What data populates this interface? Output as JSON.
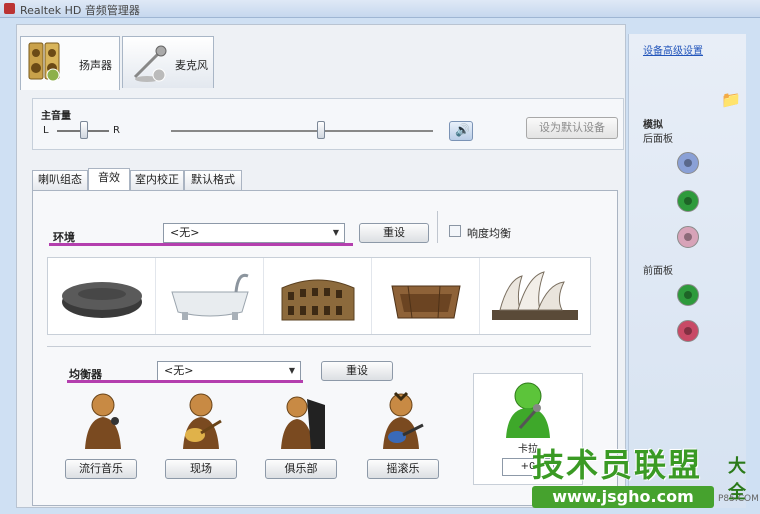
{
  "window": {
    "title": "Realtek HD 音频管理器"
  },
  "device_tabs": [
    {
      "label": "扬声器"
    },
    {
      "label": "麦克风"
    }
  ],
  "volume": {
    "title": "主音量",
    "left_label": "L",
    "right_label": "R",
    "set_default_label": "设为默认设备"
  },
  "sub_tabs": [
    {
      "label": "喇叭组态"
    },
    {
      "label": "音效"
    },
    {
      "label": "室内校正"
    },
    {
      "label": "默认格式"
    }
  ],
  "environment": {
    "label": "环境",
    "selected": "<无>",
    "reset_label": "重设",
    "loudness_label": "响度均衡",
    "loudness_checked": false,
    "thumbnails": [
      "stone-disc-icon",
      "bathtub-icon",
      "colosseum-icon",
      "arena-icon",
      "opera-house-icon"
    ]
  },
  "equalizer": {
    "label": "均衡器",
    "selected": "<无>",
    "reset_label": "重设",
    "presets": [
      {
        "label": "流行音乐"
      },
      {
        "label": "现场"
      },
      {
        "label": "俱乐部"
      },
      {
        "label": "摇滚乐"
      }
    ]
  },
  "karaoke": {
    "label": "卡拉",
    "value": "+0"
  },
  "right_panel": {
    "advanced_link": "设备高级设置",
    "analog_label": "模拟",
    "back_panel_label": "后面板",
    "front_panel_label": "前面板"
  },
  "watermark": {
    "text": "技术员联盟",
    "suffix": "大全",
    "url": "www.jsgho.com",
    "small": "P85.COM"
  },
  "colors": {
    "accent_underline": "#b43fae",
    "jack_blue": "#8aa0d6",
    "jack_green": "#2e9a3c",
    "jack_pink": "#d7a3b8",
    "jack_red": "#c84a66"
  }
}
